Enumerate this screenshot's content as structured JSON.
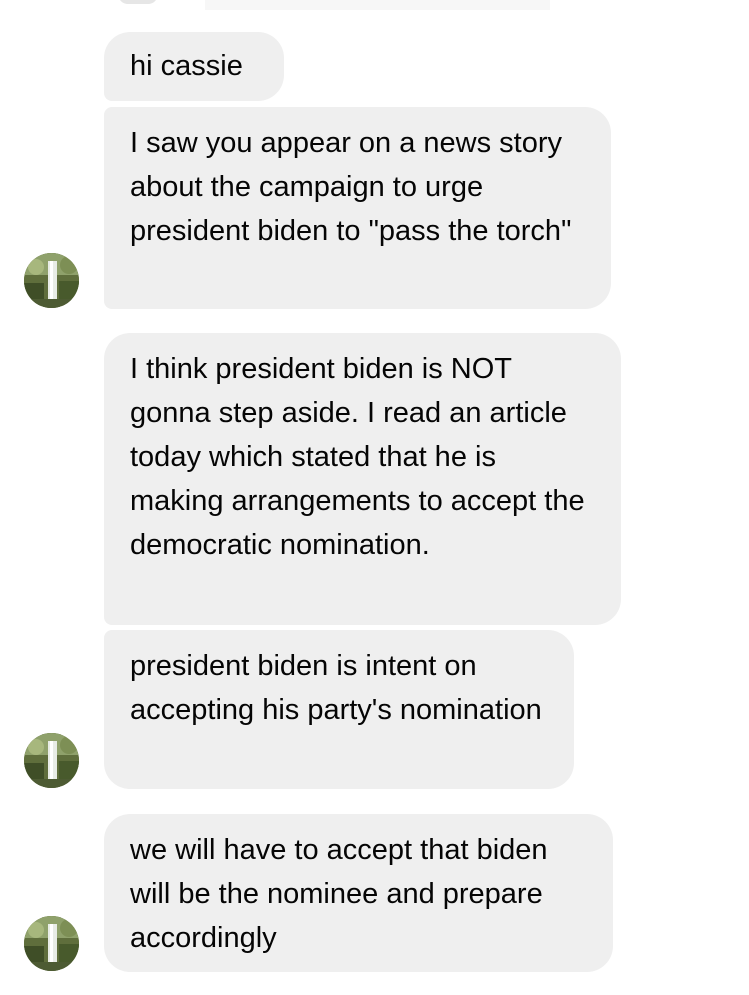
{
  "messages": [
    {
      "text": "hi cassie"
    },
    {
      "text": "I saw you appear on a news story about the campaign to urge president biden to \"pass the torch\""
    },
    {
      "text": "I think president biden is NOT gonna step aside.  I read an article today which stated that he is making arrangements to accept the democratic nomination."
    },
    {
      "text": "president biden is intent on accepting his party's nomination"
    },
    {
      "text": "we will have to accept that biden will be the nominee and prepare accordingly"
    }
  ],
  "colors": {
    "bubble_background": "#efefef",
    "text": "#050505",
    "page_background": "#ffffff"
  },
  "icons": {
    "avatar": "waterfall-forest-photo"
  }
}
